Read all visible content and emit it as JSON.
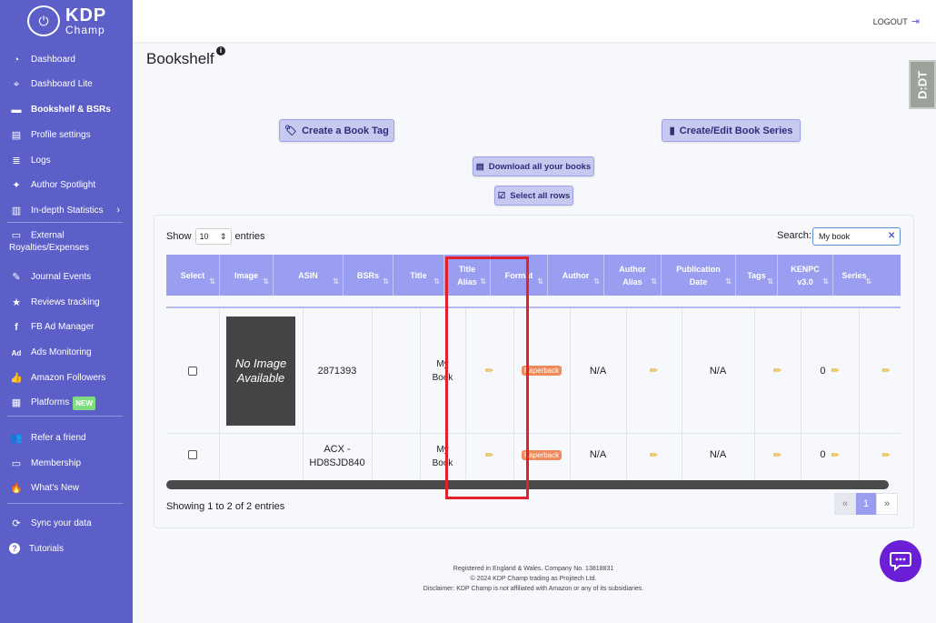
{
  "brand": {
    "mark": "⏻",
    "name": "KDP",
    "sub": "Champ"
  },
  "sidebar": {
    "items": [
      {
        "label": "Dashboard",
        "icon": "gauge-icon",
        "glyph": "◔"
      },
      {
        "label": "Dashboard Lite",
        "icon": "crosshair-icon",
        "glyph": "⌖"
      },
      {
        "label": "Bookshelf & BSRs",
        "icon": "book-icon",
        "glyph": "▬"
      },
      {
        "label": "Profile settings",
        "icon": "profile-icon",
        "glyph": "▤"
      },
      {
        "label": "Logs",
        "icon": "logs-icon",
        "glyph": "≣"
      },
      {
        "label": "Author Spotlight",
        "icon": "lightbulb-icon",
        "glyph": "✦"
      },
      {
        "label": "In-depth Statistics",
        "icon": "chart-icon",
        "glyph": "▥"
      },
      {
        "label": "External Royalties/Expenses",
        "icon": "wallet-icon",
        "glyph": "▭"
      },
      {
        "label": "Journal Events",
        "icon": "feather-icon",
        "glyph": "✎"
      },
      {
        "label": "Reviews tracking",
        "icon": "star-icon",
        "glyph": "★"
      },
      {
        "label": "FB Ad Manager",
        "icon": "facebook-icon",
        "glyph": "f"
      },
      {
        "label": "Ads Monitoring",
        "icon": "ad-icon",
        "glyph": "Ad"
      },
      {
        "label": "Amazon Followers",
        "icon": "thumbs-up-icon",
        "glyph": "👍"
      },
      {
        "label": "Platforms",
        "icon": "platforms-icon",
        "glyph": "▦",
        "badge": "NEW"
      },
      {
        "label": "Refer a friend",
        "icon": "users-icon",
        "glyph": "👥"
      },
      {
        "label": "Membership",
        "icon": "membership-icon",
        "glyph": "▭"
      },
      {
        "label": "What's New",
        "icon": "fire-icon",
        "glyph": "🔥"
      },
      {
        "label": "Sync your data",
        "icon": "sync-icon",
        "glyph": "⟳"
      },
      {
        "label": "Tutorials",
        "icon": "help-icon",
        "glyph": "?"
      }
    ]
  },
  "topbar": {
    "logout": "LOGOUT"
  },
  "page": {
    "title": "Bookshelf",
    "info": "i",
    "side_tab": "D:DT"
  },
  "buttons": {
    "create_tag": "Create a Book Tag",
    "create_series": "Create/Edit Book Series",
    "download": "Download all your books",
    "select_all": "Select all rows"
  },
  "table_controls": {
    "show": "Show",
    "page_size": "10",
    "entries": "entries",
    "search_label": "Search:",
    "search_value": "My book"
  },
  "table": {
    "columns": [
      "Select",
      "Image",
      "ASIN",
      "BSRs",
      "Title",
      "Title Alias",
      "Format",
      "Author",
      "Author Alias",
      "Publication Date",
      "Tags",
      "KENPC v3.0",
      "Series"
    ],
    "rows": [
      {
        "image": "No Image Available",
        "asin": "2871393",
        "title": "My Book",
        "format": "Paperback",
        "author": "N/A",
        "pub_date": "N/A",
        "kenpc": "0"
      },
      {
        "image": "",
        "asin": "ACX - HD8SJD840",
        "title": "My Book",
        "format": "Paperback",
        "author": "N/A",
        "pub_date": "N/A",
        "kenpc": "0"
      }
    ]
  },
  "pagination": {
    "info": "Showing 1 to 2 of 2 entries",
    "prev": "«",
    "current": "1",
    "next": "»"
  },
  "footer": {
    "line1": "Registered in England & Wales. Company No. 13818831",
    "line2": "© 2024 KDP Champ trading as Projitech Ltd.",
    "line3": "Disclaimer: KDP Champ is not affiliated with Amazon or any of its subsidiaries."
  },
  "colors": {
    "sidebar": "#5b5fc7",
    "header": "#9a9ef0",
    "highlight": "#e3202e",
    "chat": "#6a1ed6"
  }
}
